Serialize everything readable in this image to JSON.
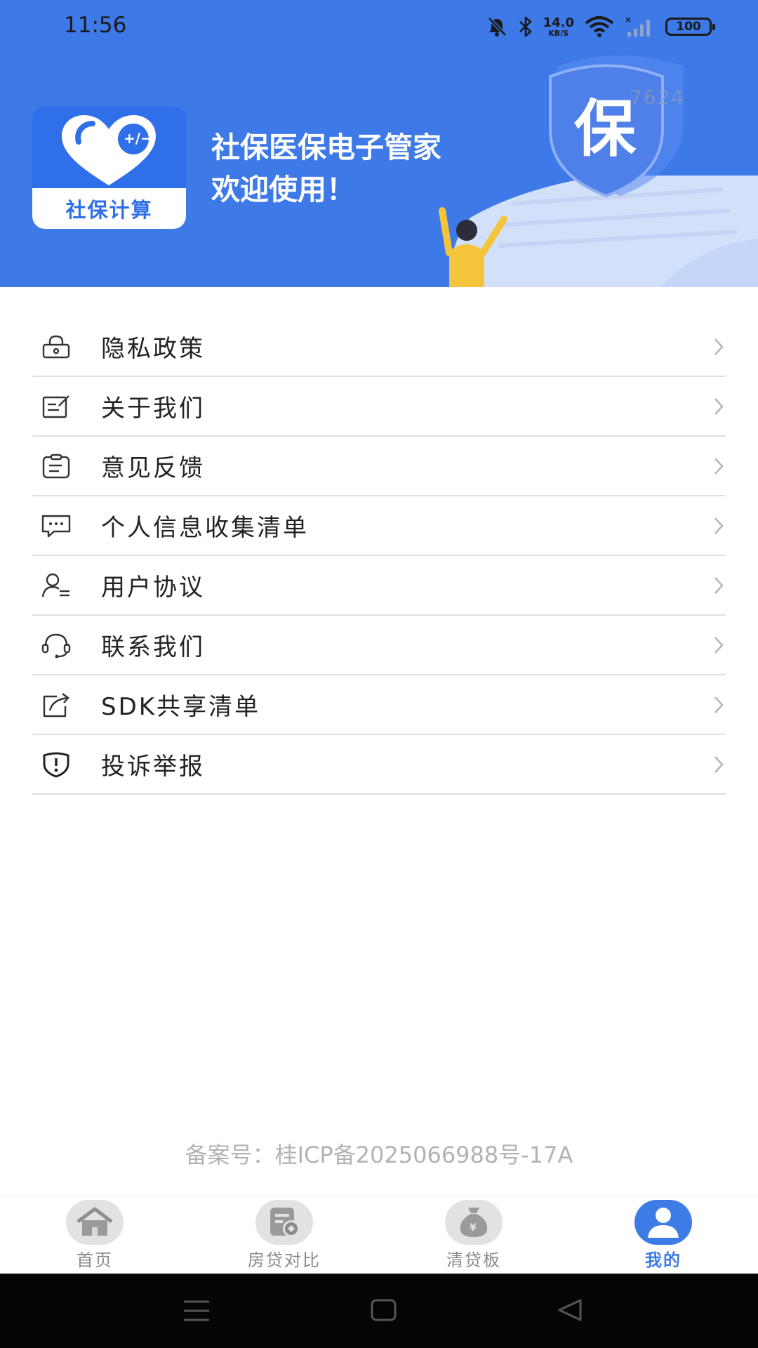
{
  "status_bar": {
    "time": "11:56",
    "net_speed_value": "14.0",
    "net_speed_unit": "KB/S",
    "battery": "100"
  },
  "header": {
    "logo_text": "社保计算",
    "welcome_line1": "社保医保电子管家",
    "welcome_line2": "欢迎使用！",
    "badge_char": "保",
    "version_watermark": "7624",
    "background_color": "#3d79e7"
  },
  "menu": {
    "items": [
      {
        "label": "隐私政策",
        "icon": "lock-icon"
      },
      {
        "label": "关于我们",
        "icon": "edit-note-icon"
      },
      {
        "label": "意见反馈",
        "icon": "clipboard-icon"
      },
      {
        "label": "个人信息收集清单",
        "icon": "chat-bubble-icon"
      },
      {
        "label": "用户协议",
        "icon": "user-list-icon"
      },
      {
        "label": "联系我们",
        "icon": "headset-icon"
      },
      {
        "label": "SDK共享清单",
        "icon": "share-icon"
      },
      {
        "label": "投诉举报",
        "icon": "shield-alert-icon"
      }
    ]
  },
  "footer": {
    "icp": "备案号：桂ICP备2025066988号-17A"
  },
  "tabbar": {
    "tabs": [
      {
        "label": "首页",
        "icon": "home-icon"
      },
      {
        "label": "房贷对比",
        "icon": "loan-compare-icon"
      },
      {
        "label": "清贷板",
        "icon": "money-bag-icon"
      },
      {
        "label": "我的",
        "icon": "user-icon"
      }
    ],
    "active_index": 3,
    "active_color": "#3d7be6",
    "inactive_color": "#8a8a8a"
  }
}
